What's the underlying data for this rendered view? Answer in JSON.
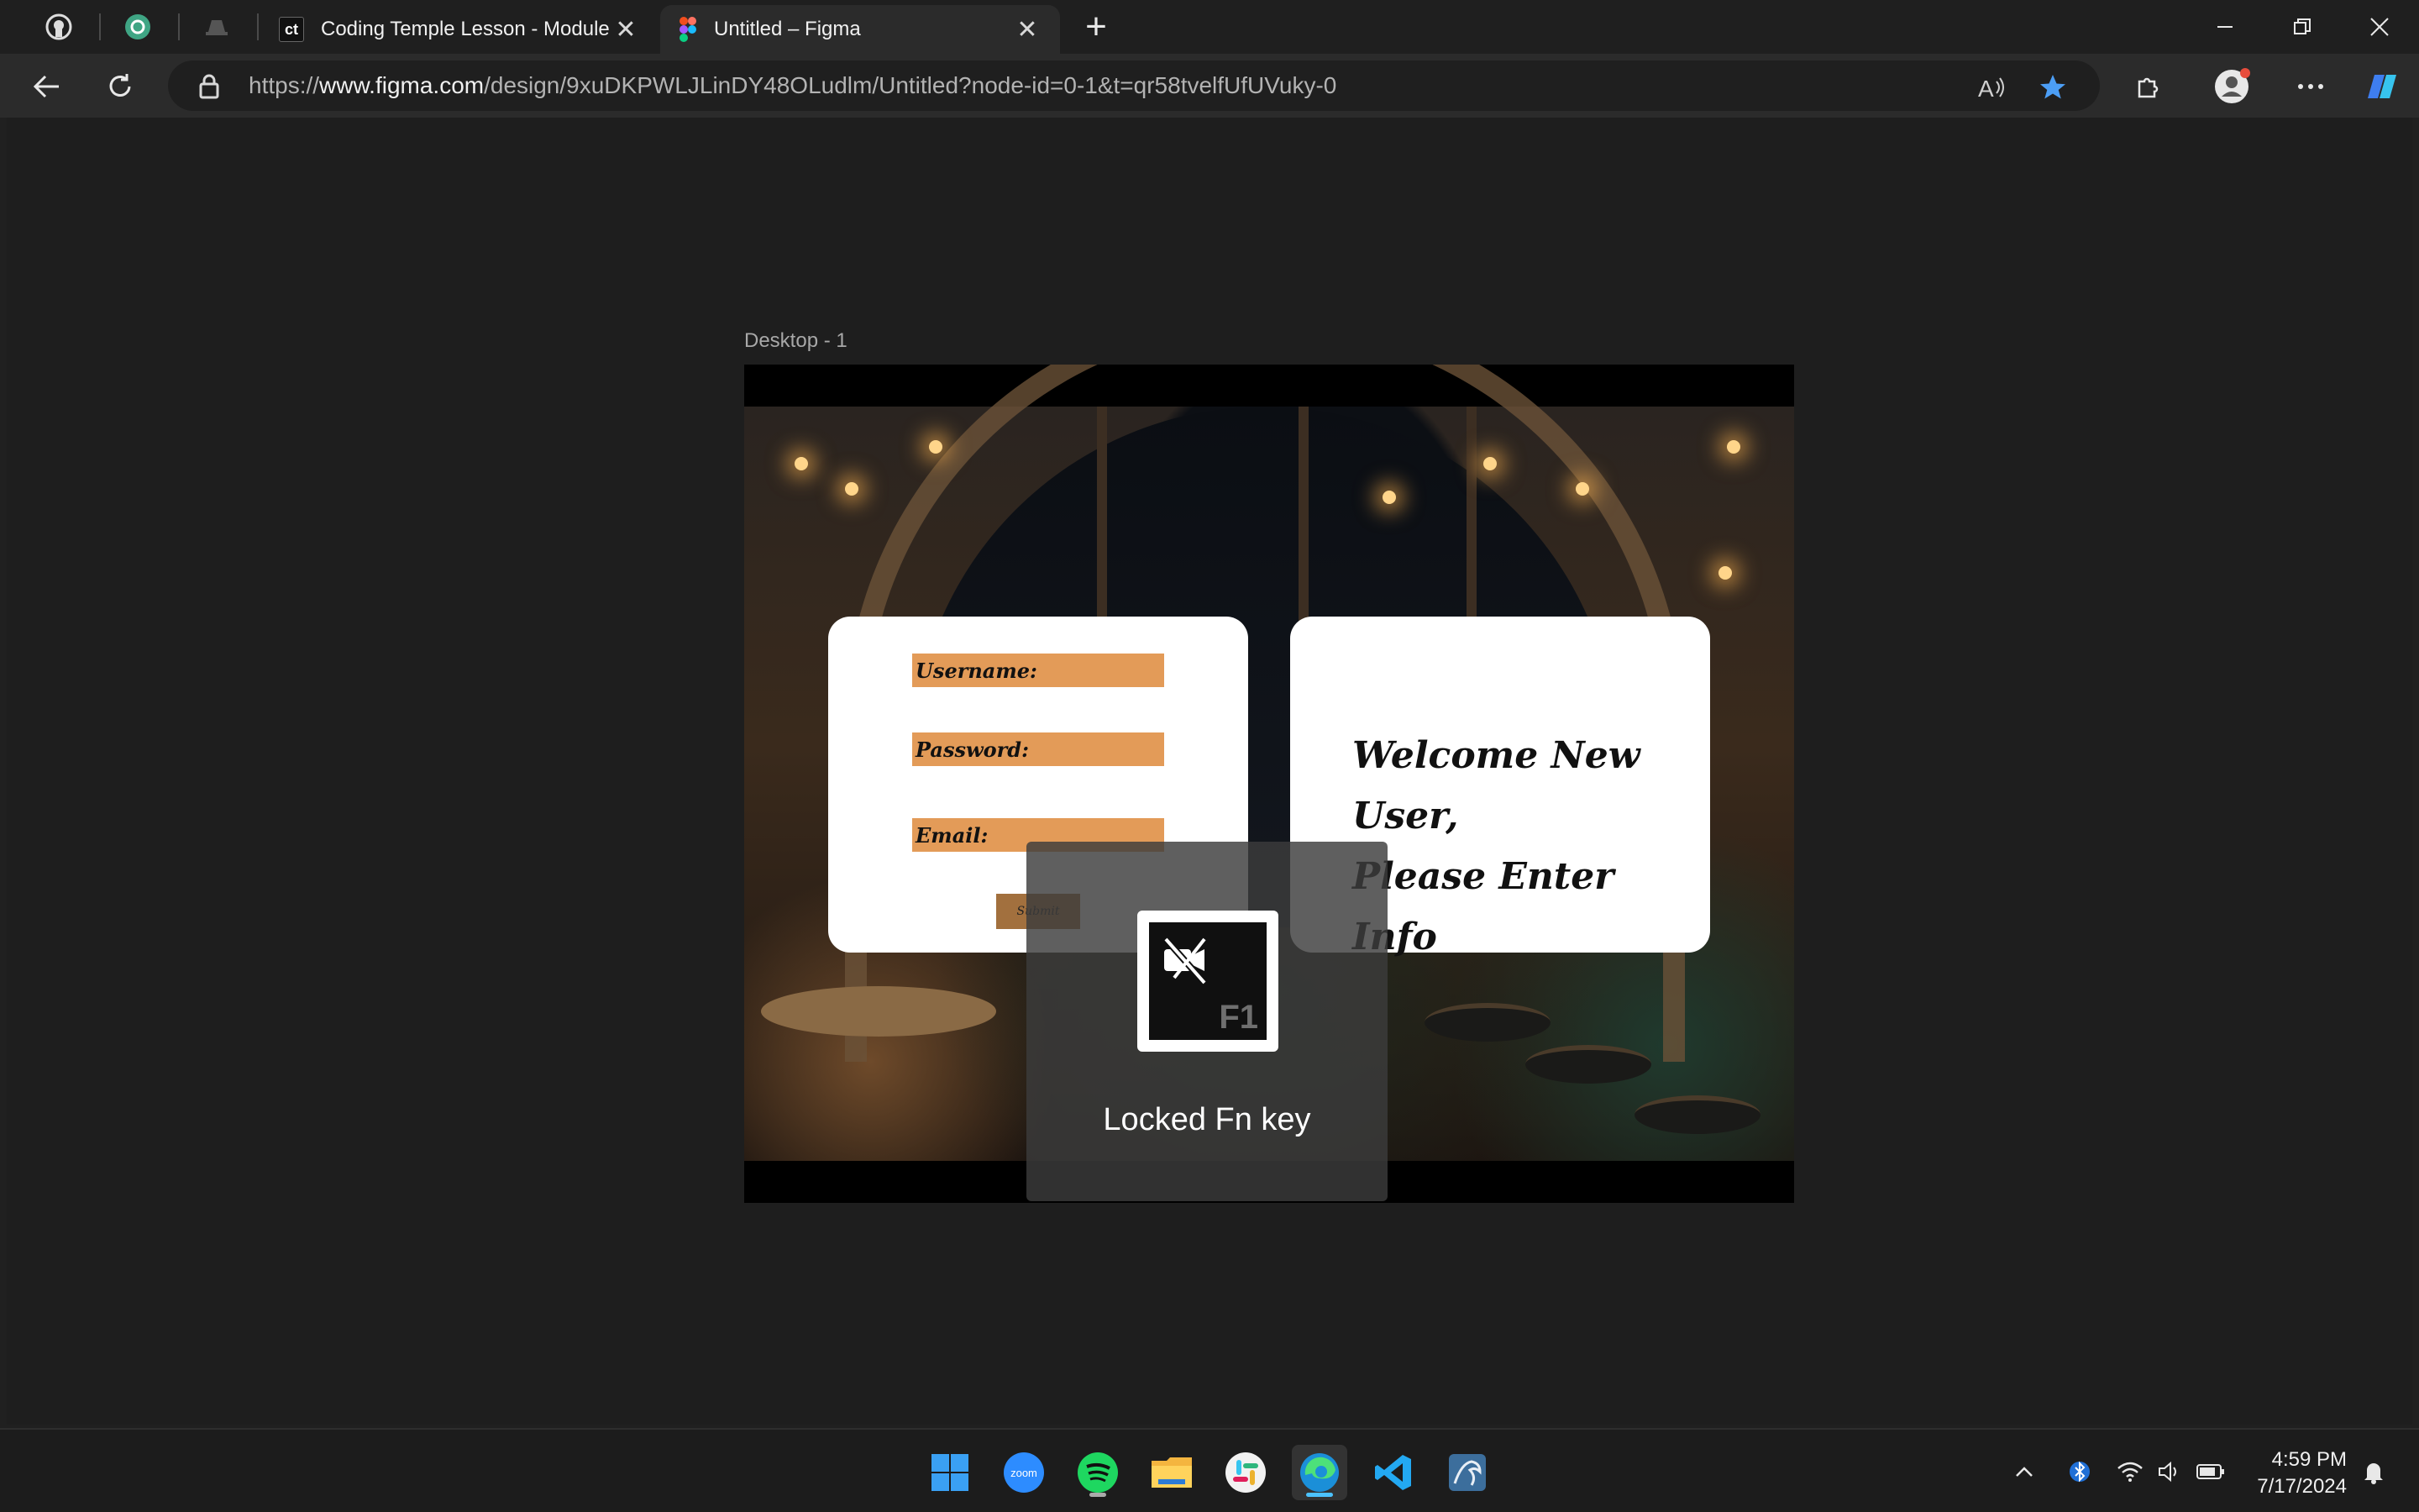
{
  "browser": {
    "tabs": [
      {
        "title": "Coding Temple Lesson - Module",
        "favicon": "ct"
      },
      {
        "title": "Untitled – Figma",
        "favicon": "figma-icon"
      }
    ],
    "close_glyph": "✕",
    "new_tab_glyph": "+",
    "url_prefix": "https://",
    "url_domain": "www.figma.com",
    "url_path": "/design/9xuDKPWLJLinDY48OLudlm/Untitled?node-id=0-1&t=qr58tvelfUfUVuky-0"
  },
  "figma": {
    "frame_label": "Desktop - 1",
    "form": {
      "username_label": "Username:",
      "password_label": "Password:",
      "email_label": "Email:",
      "submit_label": "Submit"
    },
    "welcome_line1": "Welcome New User,",
    "welcome_line2": "Please Enter Info"
  },
  "osd": {
    "key_label": "F1",
    "message": "Locked Fn key"
  },
  "taskbar": {
    "apps": [
      "start-icon",
      "zoom-icon",
      "spotify-icon",
      "file-explorer-icon",
      "slack-icon",
      "edge-icon",
      "vscode-icon",
      "mysql-workbench-icon"
    ],
    "zoom_label": "zoom",
    "time": "4:59 PM",
    "date": "7/17/2024"
  },
  "colors": {
    "accent_blue": "#4cc2ff",
    "field_orange": "#e39b58",
    "submit_brown": "#a2703e"
  }
}
